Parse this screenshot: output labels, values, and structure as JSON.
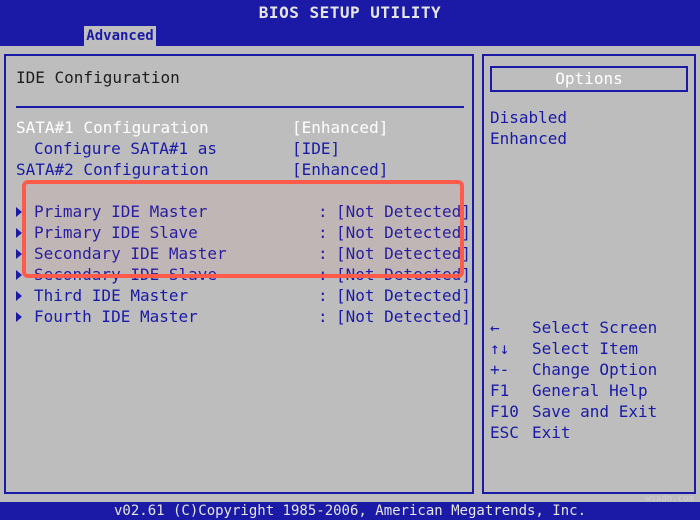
{
  "header": {
    "title": "BIOS SETUP UTILITY"
  },
  "tabs": [
    {
      "label": "Advanced"
    }
  ],
  "main": {
    "section_title": "IDE Configuration",
    "settings": [
      {
        "label": "SATA#1 Configuration",
        "value": "[Enhanced]",
        "indent": false,
        "selected": true
      },
      {
        "label": "Configure SATA#1 as",
        "value": "[IDE]",
        "indent": true,
        "selected": false
      },
      {
        "label": "SATA#2 Configuration",
        "value": "[Enhanced]",
        "indent": false,
        "selected": false
      }
    ],
    "ide_devices": [
      {
        "label": "Primary IDE Master",
        "colon": ":",
        "value": "[Not Detected]"
      },
      {
        "label": "Primary IDE Slave",
        "colon": ":",
        "value": "[Not Detected]"
      },
      {
        "label": "Secondary IDE Master",
        "colon": ":",
        "value": "[Not Detected]"
      },
      {
        "label": "Secondary IDE Slave",
        "colon": ":",
        "value": "[Not Detected]"
      },
      {
        "label": "Third IDE Master",
        "colon": ":",
        "value": "[Not Detected]"
      },
      {
        "label": "Fourth IDE Master",
        "colon": ":",
        "value": "[Not Detected]"
      }
    ]
  },
  "options": {
    "title": "Options",
    "items": [
      "Disabled",
      "Enhanced"
    ]
  },
  "help": [
    {
      "key": "←",
      "desc": "Select Screen"
    },
    {
      "key": "↑↓",
      "desc": "Select Item"
    },
    {
      "key": "+-",
      "desc": "Change Option"
    },
    {
      "key": "F1",
      "desc": "General Help"
    },
    {
      "key": "F10",
      "desc": "Save and Exit"
    },
    {
      "key": "ESC",
      "desc": "Exit"
    }
  ],
  "footer": {
    "text": "v02.61 (C)Copyright 1985-2006, American Megatrends, Inc."
  },
  "watermark": "wsxdn.com",
  "colors": {
    "bios_blue": "#1a1aa6",
    "panel_gray": "#bdbdbd",
    "highlight_red": "#ff5a4a",
    "text_white": "#ffffff"
  }
}
